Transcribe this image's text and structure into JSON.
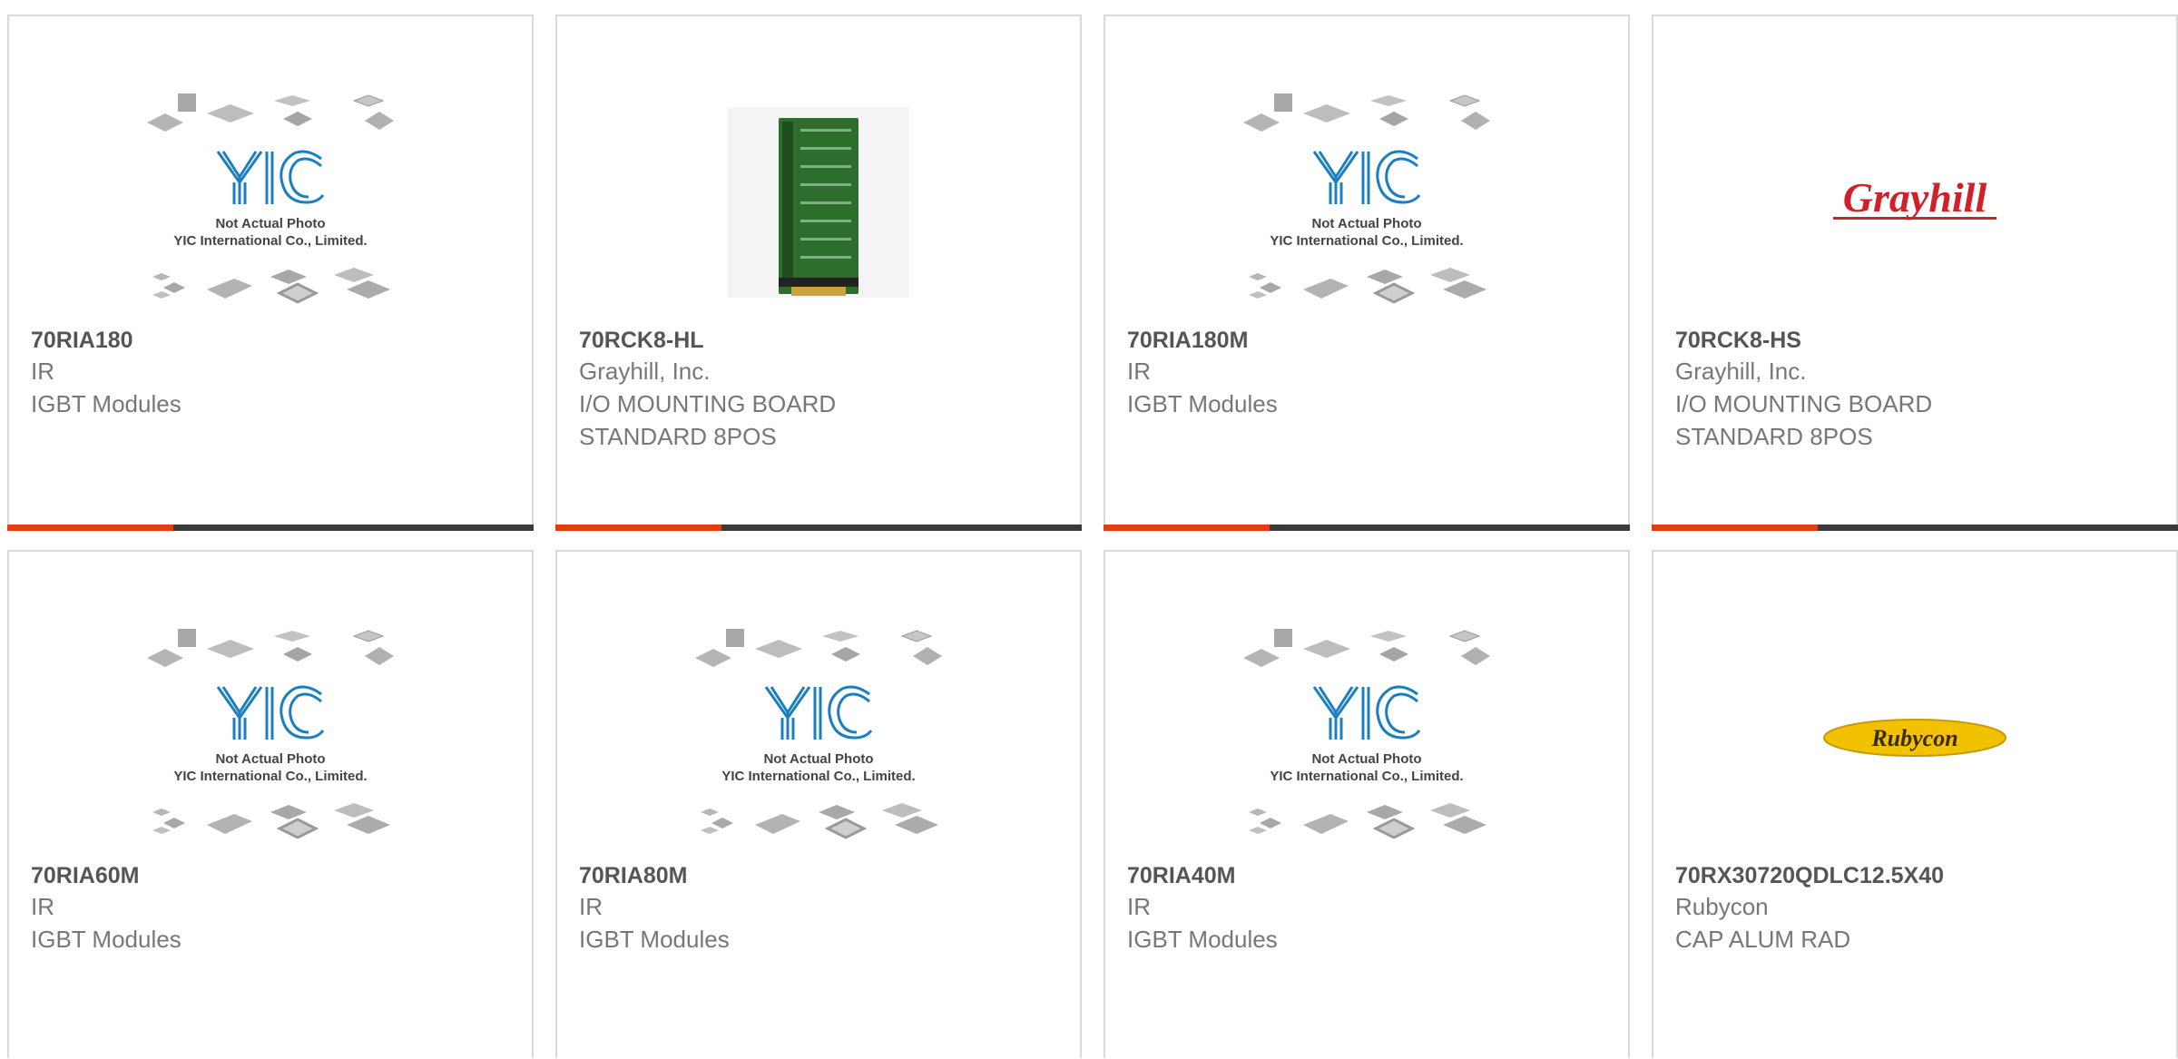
{
  "colors": {
    "accent": "#e43d12",
    "bar": "#3b3b3b",
    "pn": "#555555",
    "text": "#777777",
    "border": "#d9d9d9",
    "yic_blue": "#1a7fc1",
    "grayhill_red": "#d0202a",
    "rubycon_yellow": "#f2c200",
    "board_green": "#2d6e2d"
  },
  "placeholder": {
    "line1": "Not Actual Photo",
    "line2": "YIC International Co., Limited.",
    "logo": "YIC"
  },
  "products": [
    {
      "part_number": "70RIA180",
      "manufacturer": "IR",
      "description": "IGBT Modules",
      "image": "yic-placeholder"
    },
    {
      "part_number": "70RCK8-HL",
      "manufacturer": "Grayhill, Inc.",
      "description": "I/O MOUNTING BOARD\nSTANDARD 8POS",
      "image": "green-circuit-board"
    },
    {
      "part_number": "70RIA180M",
      "manufacturer": "IR",
      "description": "IGBT Modules",
      "image": "yic-placeholder"
    },
    {
      "part_number": "70RCK8-HS",
      "manufacturer": "Grayhill, Inc.",
      "description": "I/O MOUNTING BOARD\nSTANDARD 8POS",
      "image": "grayhill-logo",
      "logo_text": "Grayhill"
    },
    {
      "part_number": "70RIA60M",
      "manufacturer": "IR",
      "description": "IGBT Modules",
      "image": "yic-placeholder"
    },
    {
      "part_number": "70RIA80M",
      "manufacturer": "IR",
      "description": "IGBT Modules",
      "image": "yic-placeholder"
    },
    {
      "part_number": "70RIA40M",
      "manufacturer": "IR",
      "description": "IGBT Modules",
      "image": "yic-placeholder"
    },
    {
      "part_number": "70RX30720QDLC12.5X40",
      "manufacturer": "Rubycon",
      "description": "CAP ALUM RAD",
      "image": "rubycon-logo",
      "logo_text": "Rubycon"
    }
  ]
}
